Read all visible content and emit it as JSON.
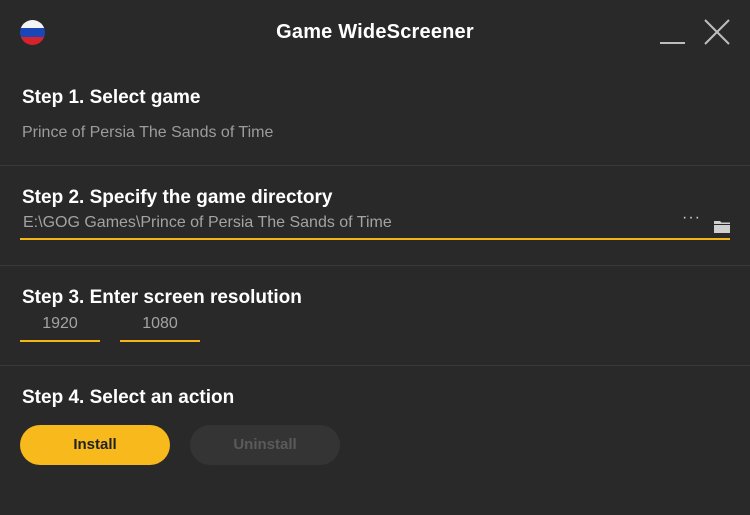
{
  "app": {
    "title": "Game WideScreener",
    "language_flag": "russia-flag-icon",
    "accent_color": "#f7b91b",
    "background_color": "#292929"
  },
  "step1": {
    "title": "Step 1. Select game",
    "selected_game": "Prince of Persia The Sands of Time"
  },
  "step2": {
    "title": "Step 2. Specify the game directory",
    "directory_value": "E:\\GOG Games\\Prince of Persia The Sands of Time",
    "browse_label": "···"
  },
  "step3": {
    "title": "Step 3. Enter screen resolution",
    "width_value": "1920",
    "height_value": "1080"
  },
  "step4": {
    "title": "Step 4. Select an action",
    "install_label": "Install",
    "uninstall_label": "Uninstall"
  }
}
